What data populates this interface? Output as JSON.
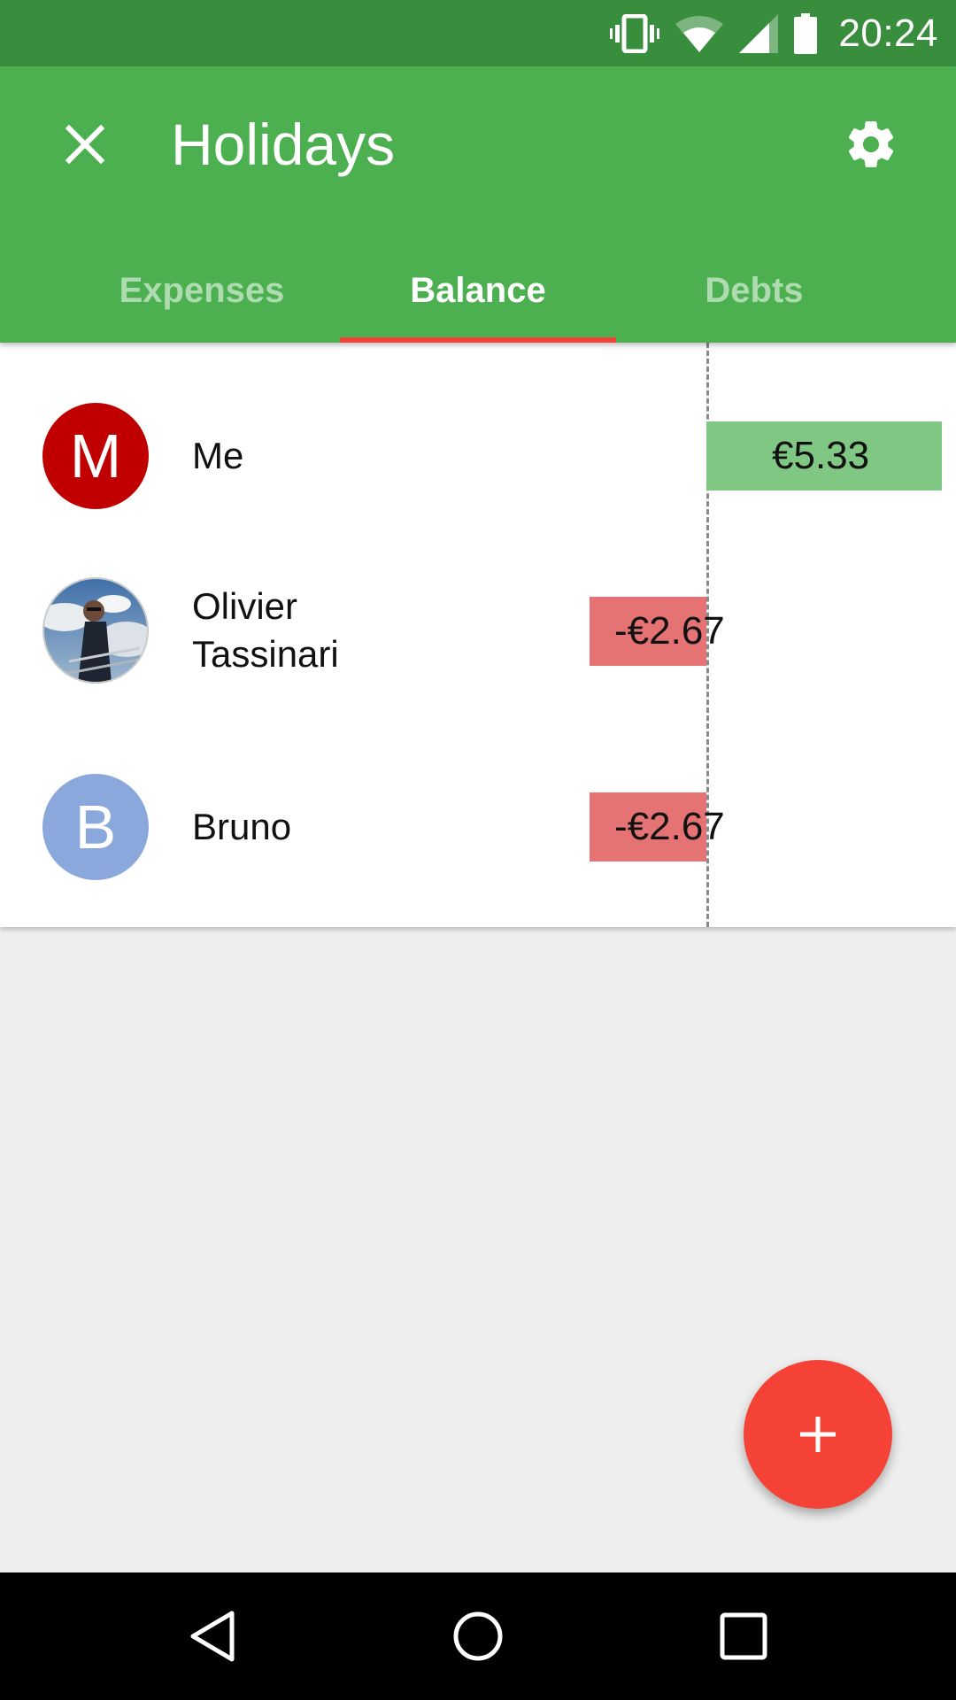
{
  "status_bar": {
    "time": "20:24",
    "icons": [
      "vibrate-icon",
      "wifi-icon",
      "signal-icon",
      "battery-icon"
    ]
  },
  "app_bar": {
    "title": "Holidays",
    "close_icon": "close-icon",
    "settings_icon": "gear-icon",
    "color": "#4CAF50"
  },
  "tabs": [
    {
      "label": "Expenses",
      "active": false
    },
    {
      "label": "Balance",
      "active": true
    },
    {
      "label": "Debts",
      "active": false
    }
  ],
  "balance": {
    "members": [
      {
        "name": "Me",
        "initial": "M",
        "avatar_color": "#C00000",
        "amount": "€5.33",
        "value": 5.33
      },
      {
        "name": "Olivier\nTassinari",
        "initial": "",
        "avatar_color": "",
        "amount": "-€2.67",
        "value": -2.67
      },
      {
        "name": "Bruno",
        "initial": "B",
        "avatar_color": "#8AA8DB",
        "amount": "-€2.67",
        "value": -2.67
      }
    ],
    "positive_color": "#81C784",
    "negative_color": "#E57373"
  },
  "fab": {
    "icon": "plus-icon",
    "color": "#F44336"
  },
  "nav_bar": {
    "icons": [
      "back-icon",
      "home-icon",
      "recents-icon"
    ]
  }
}
